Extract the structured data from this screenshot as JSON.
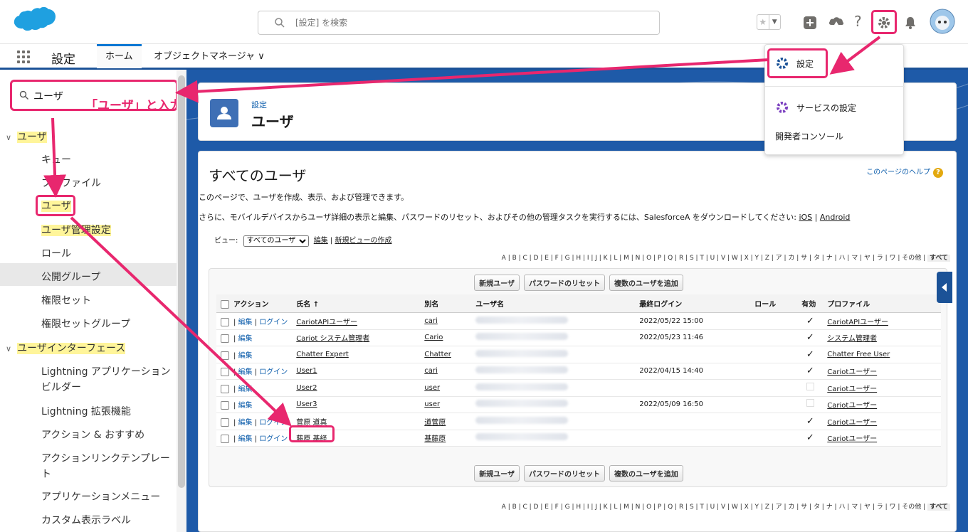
{
  "header": {
    "search_placeholder": "[設定] を検索"
  },
  "nav": {
    "title": "設定",
    "tabs": [
      {
        "label": "ホーム"
      },
      {
        "label": "オブジェクトマネージャ ∨"
      }
    ]
  },
  "sidebar": {
    "quickfind_value": "ユーザ",
    "annotation": "「ユーザ」と入力",
    "items": [
      {
        "label": "ユーザ",
        "group": true
      },
      {
        "label": "キュー"
      },
      {
        "label": "プロファイル"
      },
      {
        "label": "ユーザ"
      },
      {
        "label": "ユーザ管理設定"
      },
      {
        "label": "ロール"
      },
      {
        "label": "公開グループ"
      },
      {
        "label": "権限セット"
      },
      {
        "label": "権限セットグループ"
      },
      {
        "label": "ユーザインターフェース",
        "group": true
      },
      {
        "label": "Lightning アプリケーションビルダー"
      },
      {
        "label": "Lightning 拡張機能"
      },
      {
        "label": "アクション & おすすめ"
      },
      {
        "label": "アクションリンクテンプレート"
      },
      {
        "label": "アプリケーションメニュー"
      },
      {
        "label": "カスタム表示ラベル"
      }
    ]
  },
  "page_header": {
    "breadcrumb": "設定",
    "title": "ユーザ"
  },
  "content": {
    "title": "すべてのユーザ",
    "help": "このページのヘルプ",
    "desc1": "このページで、ユーザを作成、表示、および管理できます。",
    "desc2": "さらに、モバイルデバイスからユーザ詳細の表示と編集、パスワードのリセット、およびその他の管理タスクを実行するには、SalesforceA をダウンロードしてください: ",
    "link_ios": "iOS",
    "link_sep": " | ",
    "link_android": "Android",
    "view_label": "ビュー:",
    "view_selected": "すべてのユーザ",
    "view_edit": "編集",
    "view_sep": " | ",
    "view_new": "新規ビューの作成",
    "alphabet": "A | B | C | D | E | F | G | H | I | J | K | L | M | N | O | P | Q | R | S | T | U | V | W | X | Y | Z | ア | カ | サ | タ | ナ | ハ | マ | ヤ | ラ | ワ | その他 | ",
    "alphabet_all": "すべて"
  },
  "buttons": {
    "new_user": "新規ユーザ",
    "reset_pw": "パスワードのリセット",
    "add_multiple": "複数のユーザを追加"
  },
  "table": {
    "headers": {
      "action": "アクション",
      "name": "氏名 ↑",
      "alias": "別名",
      "username": "ユーザ名",
      "last_login": "最終ログイン",
      "role": "ロール",
      "active": "有効",
      "profile": "プロファイル"
    },
    "rows": [
      {
        "act1": "編集",
        "act2": "ログイン",
        "name": "CariotAPIユーザー",
        "alias": "cari",
        "last_login": "2022/05/22 15:00",
        "active": "✓",
        "profile": "CariotAPIユーザー"
      },
      {
        "act1": "編集",
        "act2": "",
        "name": "Cariot システム管理者",
        "alias": "Cario",
        "last_login": "2022/05/23 11:46",
        "active": "✓",
        "profile": "システム管理者"
      },
      {
        "act1": "編集",
        "act2": "",
        "name": "Chatter Expert",
        "alias": "Chatter",
        "last_login": "",
        "active": "✓",
        "profile": "Chatter Free User"
      },
      {
        "act1": "編集",
        "act2": "ログイン",
        "name": "User1",
        "alias": "cari",
        "last_login": "2022/04/15 14:40",
        "active": "✓",
        "profile": "Cariotユーザー"
      },
      {
        "act1": "編集",
        "act2": "",
        "name": "User2",
        "alias": "user",
        "last_login": "",
        "active": "",
        "profile": "Cariotユーザー"
      },
      {
        "act1": "編集",
        "act2": "",
        "name": "User3",
        "alias": "user",
        "last_login": "2022/05/09 16:50",
        "active": "",
        "profile": "Cariotユーザー"
      },
      {
        "act1": "編集",
        "act2": "ログイン",
        "name": "菅原 道真",
        "alias": "道菅原",
        "last_login": "",
        "active": "✓",
        "profile": "Cariotユーザー"
      },
      {
        "act1": "編集",
        "act2": "ログイン",
        "name": "藤原 基経",
        "alias": "基藤原",
        "last_login": "",
        "active": "✓",
        "profile": "Cariotユーザー"
      }
    ]
  },
  "menu": {
    "setup": "設定",
    "service_setup": "サービスの設定",
    "dev_console": "開発者コンソール"
  },
  "colors": {
    "accent": "#e8276e",
    "brand": "#1b5297",
    "cloud": "#1fa0e0"
  }
}
